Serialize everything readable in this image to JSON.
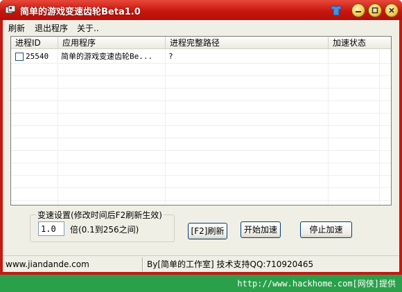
{
  "window": {
    "title": "简单的游戏变速齿轮Beta1.0",
    "controls": {
      "skin_icon": "shirt-icon",
      "minimize_icon": "minimize-icon",
      "maximize_icon": "maximize-icon",
      "close_icon": "close-icon"
    }
  },
  "menu": {
    "items": [
      "刷新",
      "退出程序",
      "关于.."
    ]
  },
  "process_list": {
    "columns": [
      "进程ID",
      "应用程序",
      "进程完整路径",
      "加速状态"
    ],
    "rows": [
      {
        "checked": false,
        "pid": "25540",
        "application": "简单的游戏变速齿轮Be...",
        "path": "?",
        "status": ""
      }
    ]
  },
  "speed_settings": {
    "group_label": "变速设置(修改时间后F2刷新生效)",
    "value": "1.0",
    "hint": "倍(0.1到256之间)"
  },
  "buttons": {
    "refresh": "[F2]刷新",
    "start": "开始加速",
    "stop": "停止加速"
  },
  "status_bar": {
    "website": "www.jiandande.com",
    "credits": "By[简单的工作室] 技术支持QQ:710920465"
  },
  "watermark": "http://www.hackhome.com[网侠]提供",
  "colors": {
    "title_bar": "#c8160e",
    "watermark_bar": "#2aa04a",
    "window_face": "#f0efe6"
  }
}
